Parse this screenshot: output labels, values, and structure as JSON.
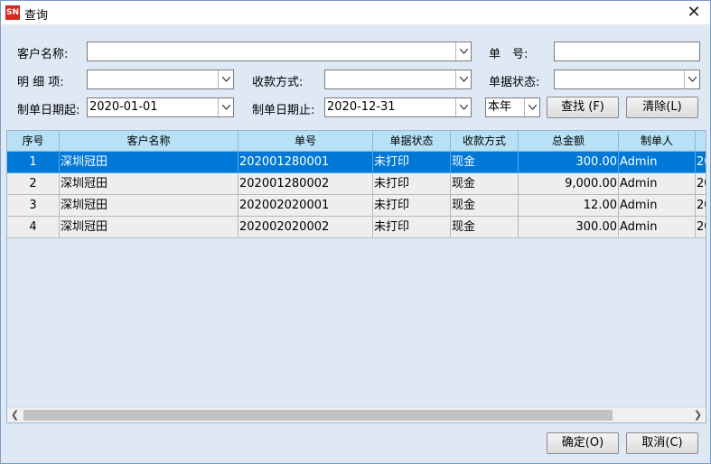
{
  "window": {
    "title": "查询",
    "app_icon_text": "SN",
    "close_glyph": "✕"
  },
  "filters": {
    "customer_name_label": "客户名称:",
    "customer_name_value": "",
    "doc_no_label": "单　号:",
    "doc_no_value": "",
    "detail_label": "明 细 项:",
    "detail_value": "",
    "payment_label": "收款方式:",
    "payment_value": "",
    "status_label": "单据状态:",
    "status_value": "",
    "date_from_label": "制单日期起:",
    "date_from_value": "2020-01-01",
    "date_to_label": "制单日期止:",
    "date_to_value": "2020-12-31",
    "period_value": "本年",
    "search_label": "查找 (F)",
    "clear_label": "清除(L)"
  },
  "table": {
    "columns": [
      "序号",
      "客户名称",
      "单号",
      "单据状态",
      "收款方式",
      "总金额",
      "制单人",
      ""
    ],
    "rows": [
      {
        "no": "1",
        "customer": "深圳冠田",
        "doc": "202001280001",
        "status": "未打印",
        "payment": "现金",
        "amount": "300.00",
        "creator": "Admin",
        "extra": "20",
        "selected": true
      },
      {
        "no": "2",
        "customer": "深圳冠田",
        "doc": "202001280002",
        "status": "未打印",
        "payment": "现金",
        "amount": "9,000.00",
        "creator": "Admin",
        "extra": "20",
        "selected": false
      },
      {
        "no": "3",
        "customer": "深圳冠田",
        "doc": "202002020001",
        "status": "未打印",
        "payment": "现金",
        "amount": "12.00",
        "creator": "Admin",
        "extra": "20",
        "selected": false
      },
      {
        "no": "4",
        "customer": "深圳冠田",
        "doc": "202002020002",
        "status": "未打印",
        "payment": "现金",
        "amount": "300.00",
        "creator": "Admin",
        "extra": "20",
        "selected": false
      }
    ]
  },
  "footer": {
    "ok_label": "确定(O)",
    "cancel_label": "取消(C)"
  },
  "colors": {
    "selected_row": "#0078d7",
    "header_bg": "#b8e1f6",
    "window_bg": "#dfe9f5"
  }
}
